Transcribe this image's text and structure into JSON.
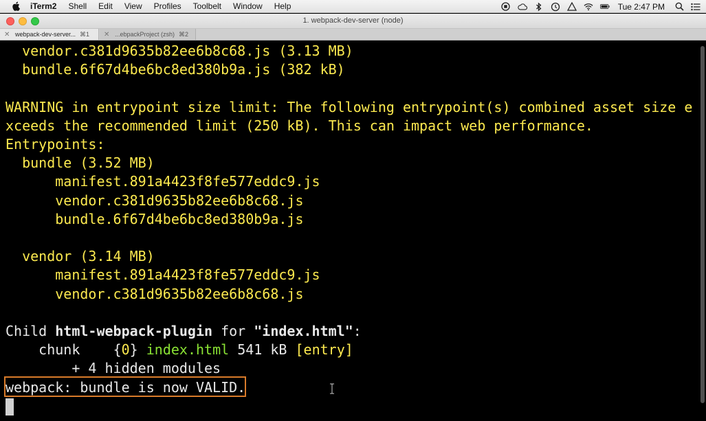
{
  "menubar": {
    "app_name": "iTerm2",
    "menus": [
      "Shell",
      "Edit",
      "View",
      "Profiles",
      "Toolbelt",
      "Window",
      "Help"
    ],
    "clock": "Tue 2:47 PM",
    "status_icons": [
      "record-icon",
      "cloud-icon",
      "bluetooth-icon",
      "time-machine-icon",
      "vpn-icon",
      "wifi-icon",
      "battery-icon",
      "search-icon",
      "list-icon"
    ]
  },
  "window": {
    "title": "1. webpack-dev-server (node)"
  },
  "tabs": [
    {
      "label": "webpack-dev-server...",
      "shortcut": "⌘1",
      "active": true
    },
    {
      "label": "...ebpackProject (zsh)",
      "shortcut": "⌘2",
      "active": false
    }
  ],
  "terminal": {
    "lines": [
      {
        "indent": "  ",
        "text": "vendor.c381d9635b82ee6b8c68.js (3.13 MB)",
        "color": "yellow"
      },
      {
        "indent": "  ",
        "text": "bundle.6f67d4be6bc8ed380b9a.js (382 kB)",
        "color": "yellow"
      },
      {
        "indent": "",
        "text": "",
        "color": "yellow"
      },
      {
        "indent": "",
        "text": "WARNING in entrypoint size limit: The following entrypoint(s) combined asset size e",
        "color": "yellow"
      },
      {
        "indent": "",
        "text": "xceeds the recommended limit (250 kB). This can impact web performance.",
        "color": "yellow"
      },
      {
        "indent": "",
        "text": "Entrypoints:",
        "color": "yellow"
      },
      {
        "indent": "  ",
        "text": "bundle (3.52 MB)",
        "color": "yellow"
      },
      {
        "indent": "      ",
        "text": "manifest.891a4423f8fe577eddc9.js",
        "color": "yellow"
      },
      {
        "indent": "      ",
        "text": "vendor.c381d9635b82ee6b8c68.js",
        "color": "yellow"
      },
      {
        "indent": "      ",
        "text": "bundle.6f67d4be6bc8ed380b9a.js",
        "color": "yellow"
      },
      {
        "indent": "",
        "text": "",
        "color": "yellow"
      },
      {
        "indent": "  ",
        "text": "vendor (3.14 MB)",
        "color": "yellow"
      },
      {
        "indent": "      ",
        "text": "manifest.891a4423f8fe577eddc9.js",
        "color": "yellow"
      },
      {
        "indent": "      ",
        "text": "vendor.c381d9635b82ee6b8c68.js",
        "color": "yellow"
      }
    ],
    "child_line": {
      "prefix": "Child ",
      "plugin": "html-webpack-plugin",
      "middle": " for ",
      "target": "\"index.html\"",
      "suffix": ":"
    },
    "chunk_line": {
      "indent": "    ",
      "label": "chunk",
      "gap": "    ",
      "brace_open": "{",
      "id": "0",
      "brace_close": "}",
      "asset": "index.html",
      "size": "541 kB",
      "tag": "[entry]"
    },
    "hidden_line": "        + 4 hidden modules",
    "valid_line": "webpack: bundle is now VALID."
  },
  "colors": {
    "terminal_bg": "#000000",
    "yellow_text": "#fce94f",
    "green_text": "#8ae234",
    "white_text": "#e8e8e8",
    "highlight_border": "#d97b2a"
  }
}
